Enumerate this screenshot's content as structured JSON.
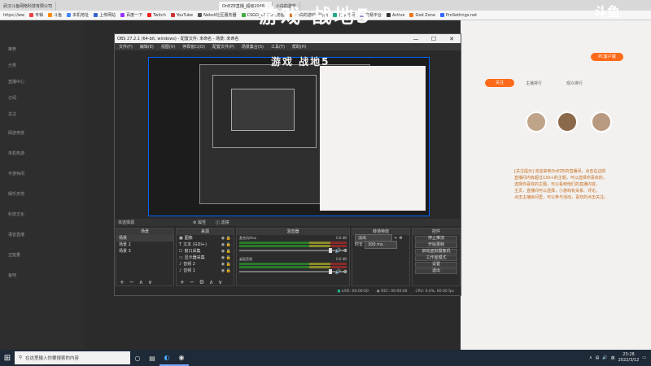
{
  "browser": {
    "tabs": [
      {
        "label": "武汉斗鱼网络科技有限公司",
        "active": false
      },
      {
        "label": "OnEZE直播_超级2048...",
        "active": true
      },
      {
        "label": "小白的游戏",
        "active": false
      },
      {
        "label": "战地5",
        "active": false
      }
    ],
    "address": "https://ww",
    "bookmarks": [
      "专辑",
      "斗鱼",
      "本机地址",
      "上传网站",
      "百度一下",
      "Twitch",
      "YouTube",
      "Nekoli社区服务器",
      "CSGO_CSGO服务器",
      "小白的游戏服务器",
      "北京时间",
      "交易平台",
      "Active",
      "God Zone",
      "ProSettings.net",
      "红 Jing下载",
      "其他收藏夹"
    ]
  },
  "watermark": {
    "text": "游戏 战地5",
    "right_text": "斗鱼"
  },
  "site_left": {
    "items": [
      "推荐",
      "分类",
      "直播中心",
      "订阅",
      "关注",
      "网游竞技",
      "单机热游",
      "手游休闲",
      "娱乐天地",
      "科技文化",
      "语音直播",
      "正能量",
      "鱼吧"
    ]
  },
  "site_right": {
    "ad_lines": [
      "[关注提示] 欢迎来到OnEZE的直播间，点击右边的",
      "直播间内有超过130+的主题，可以选择你喜欢的，",
      "选择你喜欢的主题，可以看到他们的直播内容。",
      "主页，直播间可以选择，小游戏有关系、评论，",
      "点击主播房间里，可以参与活动，喜欢的点击关注。"
    ],
    "pc_button": "PC客户端",
    "follow_button": "关注",
    "user_tags": [
      "主播排行",
      "观众排行"
    ]
  },
  "obs": {
    "title": "OBS 27.2.1 (64-bit, windows) - 配置文件: 未命名 - 场景: 未命名",
    "menu": [
      "文件(F)",
      "编辑(E)",
      "视图(V)",
      "停靠窗口(D)",
      "配置文件(P)",
      "场景集合(S)",
      "工具(T)",
      "帮助(H)"
    ],
    "scene_bar": {
      "no_source": "未选择源",
      "properties": "属性",
      "filters": "滤镜"
    },
    "preview_watermark": "游戏 战地5",
    "docks": {
      "scenes": {
        "title": "场景",
        "items": [
          "场景",
          "场景 2",
          "场景 3"
        ]
      },
      "sources": {
        "title": "来源",
        "items": [
          "图像",
          "文本 (GDI+)",
          "窗口采集",
          "显示器采集",
          "音频 2",
          "音频 1"
        ]
      },
      "mixer": {
        "title": "混音器",
        "channels": [
          {
            "name": "麦克风/Aux",
            "db": "0.0 dB"
          },
          {
            "name": "桌面音频",
            "db": "0.0 dB"
          }
        ]
      },
      "transitions": {
        "title": "转场特效",
        "mode": "淡出",
        "duration_label": "时长",
        "duration": "300 ms"
      },
      "controls": {
        "title": "控件",
        "buttons": [
          "停止推流",
          "开始录制",
          "启动虚拟摄像机",
          "工作室模式",
          "设置",
          "退出"
        ]
      }
    },
    "status": {
      "live": "LIVE: 00:00:00",
      "rec": "REC: 00:00:00",
      "cpu": "CPU: 0.4%, 60.00 fps"
    }
  },
  "taskbar": {
    "search_placeholder": "在这里输入你要搜索的内容",
    "time": "23:28",
    "date": "2022/3/12",
    "lang": "英"
  }
}
